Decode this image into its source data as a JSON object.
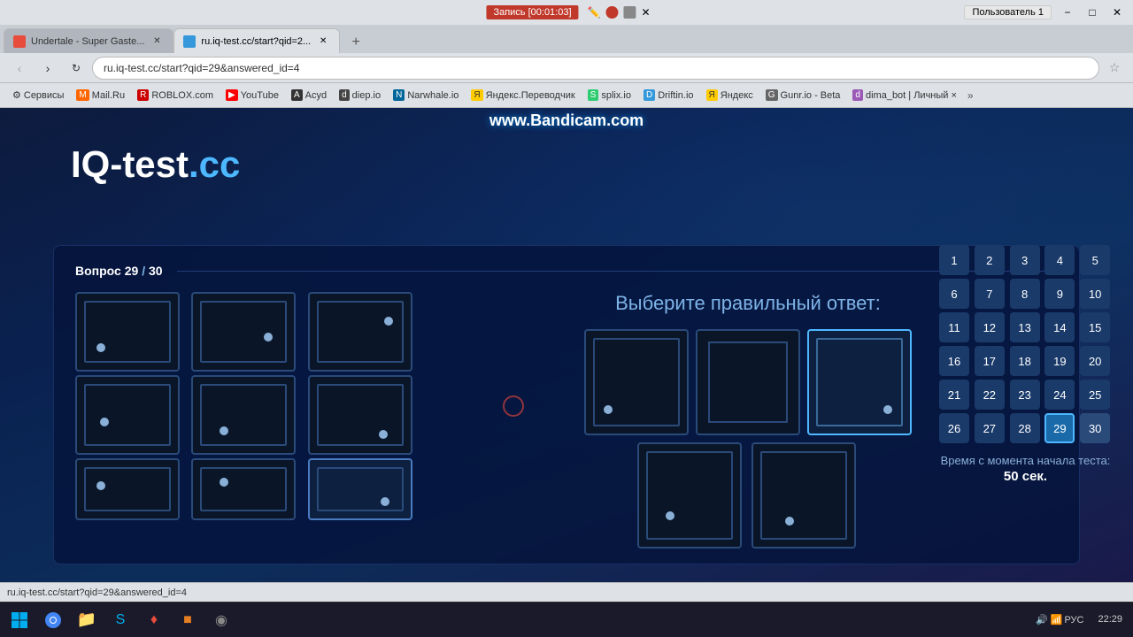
{
  "browser": {
    "titlebar": {
      "recording": "Запись [00:01:03]",
      "user": "Пользователь 1",
      "minimize": "−",
      "maximize": "□",
      "close": "✕"
    },
    "tabs": [
      {
        "id": "tab1",
        "title": "Undertale - Super Gaste...",
        "active": false,
        "favicon_color": "#e74c3c"
      },
      {
        "id": "tab2",
        "title": "ru.iq-test.cc/start?qid=2...",
        "active": true,
        "favicon_color": "#3498db"
      }
    ],
    "url": "ru.iq-test.cc/start?qid=29&answered_id=4",
    "bookmarks": [
      {
        "label": "Сервисы",
        "favicon": "⚙"
      },
      {
        "label": "Mail.Ru",
        "favicon": "📧"
      },
      {
        "label": "ROBLOX.com",
        "favicon": "🎮"
      },
      {
        "label": "YouTube",
        "favicon": "▶"
      },
      {
        "label": "Acyd",
        "favicon": "A"
      },
      {
        "label": "diep.io",
        "favicon": "●"
      },
      {
        "label": "Narwhale.io",
        "favicon": "N"
      },
      {
        "label": "Яндекс.Переводчик",
        "favicon": "Я"
      },
      {
        "label": "splix.io",
        "favicon": "S"
      },
      {
        "label": "Driftin.io",
        "favicon": "D"
      },
      {
        "label": "Яндекс",
        "favicon": "Я"
      },
      {
        "label": "Gunr.io - Beta",
        "favicon": "G"
      },
      {
        "label": "dima_bot | Личный ×",
        "favicon": "d"
      }
    ]
  },
  "page": {
    "logo": {
      "prefix": "IQ-test",
      "suffix": ".cc"
    },
    "question": {
      "label": "Вопрос",
      "current": "29",
      "total": "30"
    },
    "answer_prompt": "Выберите правильный ответ:",
    "timer_label": "Время с момента начала теста:",
    "timer_value": "50 сек.",
    "numbers": [
      1,
      2,
      3,
      4,
      5,
      6,
      7,
      8,
      9,
      10,
      11,
      12,
      13,
      14,
      15,
      16,
      17,
      18,
      19,
      20,
      21,
      22,
      23,
      24,
      25,
      26,
      27,
      28,
      29,
      30
    ],
    "current_question": 29,
    "last_question": 30
  },
  "status_bar": {
    "url": "ru.iq-test.cc/start?qid=29&answered_id=4"
  },
  "taskbar": {
    "time": "22:29",
    "lang": "РУС"
  },
  "watermark": "www.Bandicam.com"
}
